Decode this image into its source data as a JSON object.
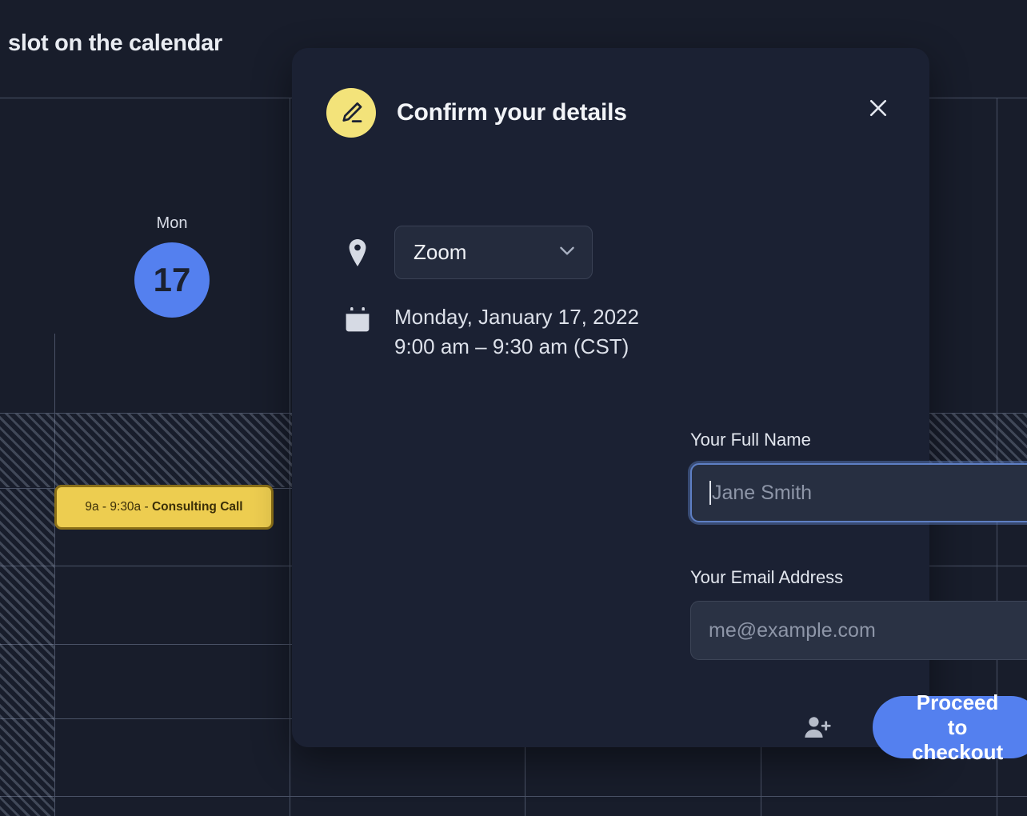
{
  "background": {
    "heading": "slot on the calendar",
    "day": {
      "name": "Mon",
      "number": "17"
    },
    "event": {
      "time": "9a - 9:30a - ",
      "title": "Consulting Call"
    }
  },
  "modal": {
    "icon": "pen-icon",
    "title": "Confirm your details",
    "close_icon": "close-icon",
    "location": {
      "icon": "map-pin-icon",
      "selected": "Zoom",
      "chevron_icon": "chevron-down-icon"
    },
    "datetime": {
      "icon": "calendar-icon",
      "date": "Monday, January 17, 2022",
      "time": "9:00 am – 9:30 am (CST)"
    },
    "fields": [
      {
        "label": "Your Full Name",
        "placeholder": "Jane Smith",
        "value": "",
        "focused": true
      },
      {
        "label": "Your Email Address",
        "placeholder": "me@example.com",
        "value": "",
        "focused": false
      }
    ],
    "footer": {
      "add_guest_icon": "add-person-icon",
      "submit_label": "Proceed to checkout"
    }
  },
  "colors": {
    "page_bg": "#181d2b",
    "modal_bg": "#1b2133",
    "accent_blue": "#5480ef",
    "accent_yellow": "#f3e37a",
    "event_yellow": "#edcd50",
    "grid_line": "#4a5266"
  }
}
